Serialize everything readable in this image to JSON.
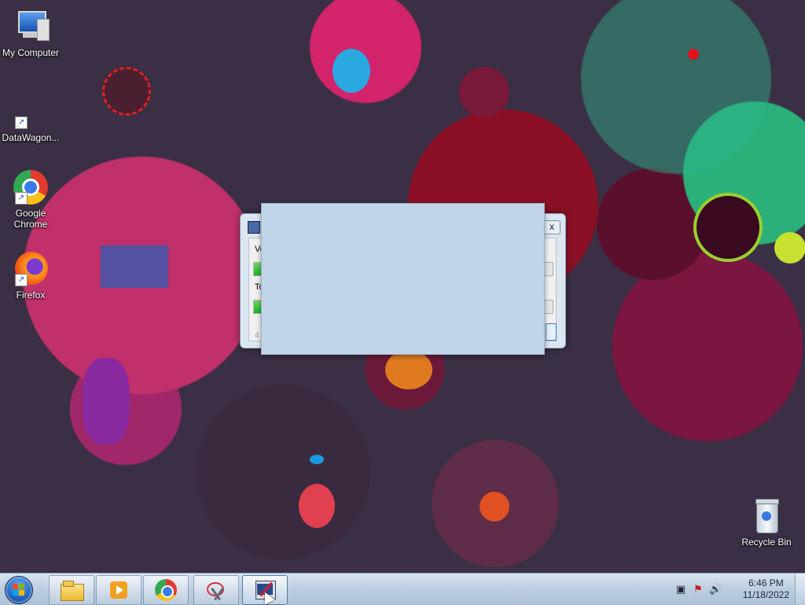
{
  "desktop": {
    "icons": [
      {
        "label": "My Computer",
        "icon": "computer-icon"
      },
      {
        "label": "DataWagon...",
        "icon": "datawagon-icon"
      },
      {
        "label": "Google Chrome",
        "icon": "chrome-icon"
      },
      {
        "label": "Firefox",
        "icon": "firefox-icon"
      },
      {
        "label": "Recycle Bin",
        "icon": "recycle-bin-icon"
      }
    ]
  },
  "dialog": {
    "label1": "Ve",
    "label2": "To",
    "progress1": 0.03,
    "progress2": 0.03,
    "footer": "4",
    "close_symbol": "x"
  },
  "taskbar": {
    "items": [
      {
        "icon": "file-explorer-icon"
      },
      {
        "icon": "media-player-icon"
      },
      {
        "icon": "chrome-icon"
      },
      {
        "icon": "snipping-tool-icon"
      },
      {
        "icon": "app-window-icon",
        "active": true
      }
    ],
    "clock_time": "6:46 PM",
    "clock_date": "11/18/2022"
  }
}
